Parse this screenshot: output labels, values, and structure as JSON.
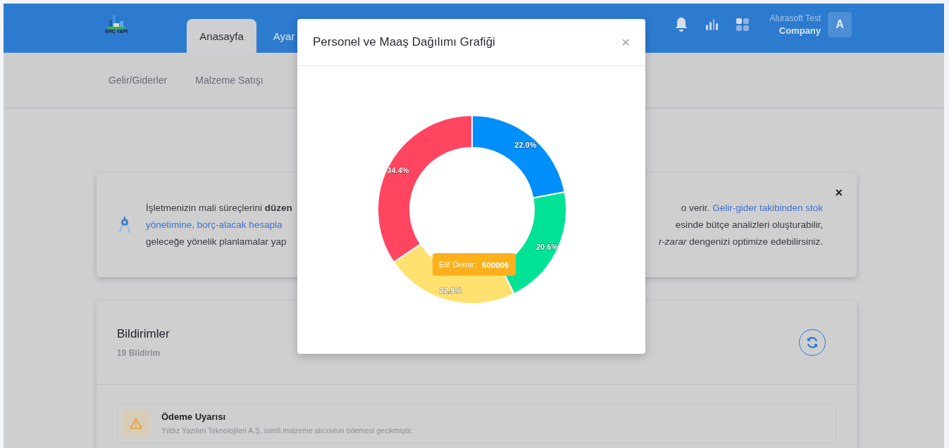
{
  "header": {
    "logo_text": "ERC YAPI",
    "tabs": [
      {
        "label": "Anasayfa",
        "selected": true
      },
      {
        "label": "Ayar",
        "selected": false
      }
    ],
    "user": {
      "name": "Alurasoft Test",
      "company": "Company",
      "avatar": "A"
    }
  },
  "subnav": [
    "Gelir/Giderler",
    "Malzeme Satışı"
  ],
  "banner": {
    "close": "×",
    "lines": [
      {
        "left": [
          {
            "kind": "text",
            "text": "İşletmenizin mali süreçlerini **düzen**"
          }
        ],
        "right": [
          {
            "kind": "text",
            "text": "o verir."
          },
          {
            "kind": "link",
            "text": "Gelir-gider takibinden stok"
          }
        ]
      },
      {
        "left": [
          {
            "kind": "link",
            "text": "yönetimine, borç-alacak hesapla"
          }
        ],
        "right": [
          {
            "kind": "text",
            "text": "esinde bütçe analizleri oluşturabilir,"
          }
        ]
      },
      {
        "left": [
          {
            "kind": "text",
            "text": "geleceğe yönelik planlamalar yap"
          }
        ],
        "right": [
          {
            "kind": "text",
            "text": "*r-zarar* dengenizi optimize edebilirsiniz."
          }
        ]
      }
    ]
  },
  "notifications": {
    "title": "Bildirimler",
    "count": "19 Bildirim",
    "items": [
      {
        "title": "Ödeme Uyarısı",
        "description": "Yıldız Yazılım Teknolojileri A.Ş. isimli malzeme alıcısının ödemesi gecikmiştir."
      }
    ]
  },
  "modal": {
    "title": "Personel ve Maaş Dağılımı Grafiği",
    "close": "×",
    "chart_data": {
      "type": "donut",
      "data_labels": true,
      "values": [
        22.0,
        20.6,
        22.9,
        34.4
      ],
      "value_labels": [
        "22.0%",
        "20.6%",
        "22.9%",
        "34.4%"
      ],
      "colors": [
        "#008ffb",
        "#00e396",
        "#fee16e",
        "#ff4560"
      ]
    },
    "tooltip": {
      "name": "Elif Demir:",
      "value": "50000₺",
      "color": "#fcb01c"
    }
  }
}
